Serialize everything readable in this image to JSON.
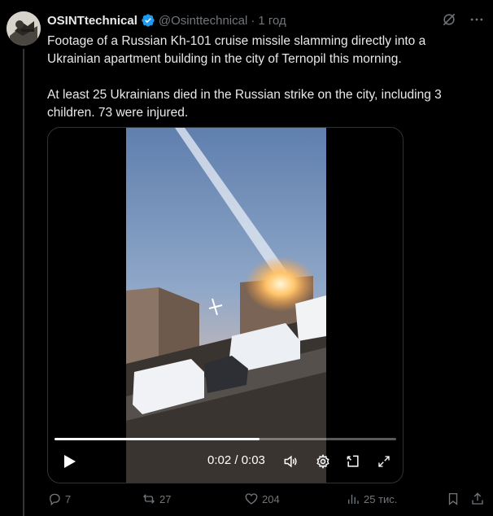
{
  "author": {
    "name": "OSINTtechnical",
    "handle": "@Osinttechnical",
    "separator": "·",
    "time": "1 год"
  },
  "tweet": {
    "paragraph1": "Footage of a Russian Kh-101 cruise missile slamming directly into a Ukrainian apartment building in the city of Ternopil this morning.",
    "paragraph2": "At least 25 Ukrainians died in the Russian strike on the city, including 3 children. 73 were injured."
  },
  "video": {
    "time": "0:02 / 0:03",
    "progress_fraction": 0.6
  },
  "actions": {
    "replies": "7",
    "reposts": "27",
    "likes": "204",
    "views": "25 тис."
  },
  "colors": {
    "background": "#000000",
    "text": "#e7e9ea",
    "muted": "#71767b",
    "verified": "#1d9bf0",
    "border": "#2f3336"
  }
}
